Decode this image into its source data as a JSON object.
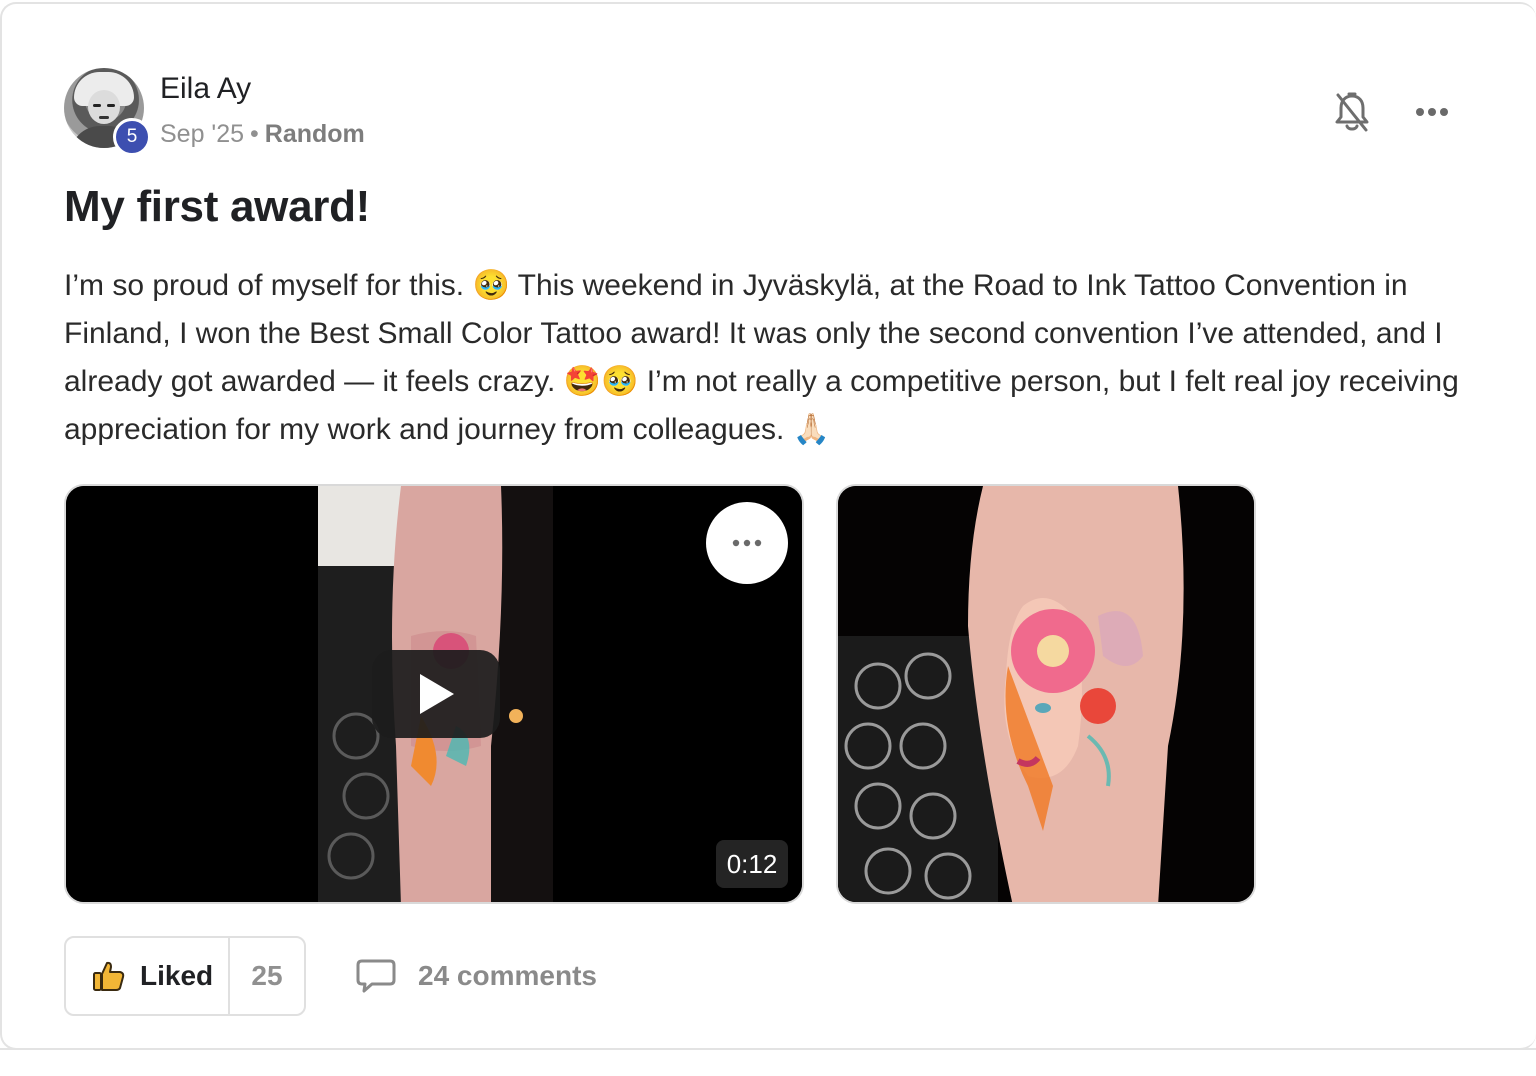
{
  "post": {
    "author": {
      "name": "Eila Ay",
      "level": "5"
    },
    "meta": {
      "date": "Sep '25",
      "separator": "•",
      "category": "Random"
    },
    "title": "My first award!",
    "body": "I’m so proud of myself for this. 🥹 This weekend in Jyväskylä, at the Road to Ink Tattoo Convention in Finland, I won the Best Small Color Tattoo award! It was only the second convention I’ve attended, and I already got awarded — it feels crazy. 🤩🥹 I’m not really a competitive person, but I felt real joy receiving appreciation for my work and journey from colleagues. 🙏🏻",
    "media": {
      "video": {
        "duration": "0:12"
      }
    },
    "footer": {
      "like_label": "Liked",
      "like_count": "25",
      "comments_label": "24 comments"
    }
  },
  "colors": {
    "badge": "#3d4fb0",
    "text": "#202124",
    "muted": "#909090",
    "border": "#e0e0e0",
    "like_icon": "#e8a317"
  },
  "icons": [
    "bell-off-icon",
    "more-horizontal-icon",
    "play-icon",
    "thumbs-up-icon",
    "comment-icon"
  ]
}
